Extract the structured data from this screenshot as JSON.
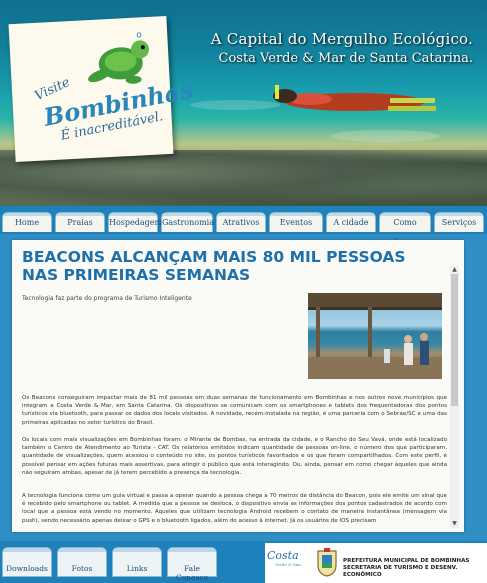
{
  "brand": {
    "visite": "Visite",
    "name": "Bombinhas",
    "tagline": "É inacreditável."
  },
  "headline": {
    "line1": "A Capital do Mergulho Ecológico.",
    "line2": "Costa Verde & Mar de Santa Catarina."
  },
  "nav": [
    "Home",
    "Praias",
    "Hospedagem",
    "Gastronomia",
    "Atrativos",
    "Eventos",
    "A cidade",
    "Como chegar",
    "Serviços"
  ],
  "article": {
    "title": "BEACONS ALCANÇAM MAIS 80 MIL PESSOAS NAS PRIMEIRAS SEMANAS",
    "subtitle": "Tecnologia faz parte do programa de Turismo Inteligente",
    "paragraphs": [
      "Os Beacons conseguiram impactar mais de 81 mil pessoas em duas semanas de funcionamento em Bombinhas e nos outros nove municípios que integram a Costa Verde & Mar, em Santa Catarina. Os dispositivos se comunicam com os smartphones e tablets dos frequentadoras dos pontos turísticos via bluetooth, para passar os dados dos locais visitados. A novidade, recém-instalada na região, é uma parceria com o Sebrae/SC e uma das primeiras aplicadas no setor turístico do Brasil.",
      "Os locais com mais visualizações em Bombinhas foram: o Mirante de Bombas, na entrada da cidade, e o Rancho do Seu Vavá, onde está localizado também o Centro de Atendimento ao Turista - CAT. Os relatórios emitidos indicam quantidade de pessoas on-line, o número dos que participaram, quantidade de visualizações, quem acessou o conteúdo no site, os pontos turísticos favoritados e os que foram compartilhados. Com este perfil, é possível pensar em ações futuras mais assertivas, para atingir o público que está interagindo. Ou, ainda, pensar em como chegar àqueles que ainda não seguiram ambas, apesar de já terem percebido a presença da tecnologia.",
      "A tecnologia funciona como um guia virtual e passa a operar quando a pessoa chega a 70 metros de distância do Beacon, pois ele emite um sinal que é recebido pelo smartphone ou tablet. A medida que a pessoa se desloca, o dispositivo envia as informações dos pontos cadastrados de acordo com local que a pessoa está vendo no momento. Aqueles que utilizam tecnologia Android recebem o contato de maneira instantânea (mensagem via push), sendo necessário apenas deixar o GPS e o bluetooth ligados, além do acesso à internet. Já os usuários de IOS precisam"
    ]
  },
  "scrollbar": {
    "up": "▲",
    "down": "▼"
  },
  "footer": {
    "tabs": [
      "Downloads",
      "Fotos",
      "Links",
      "Fale Conosco"
    ],
    "costa_logo": "Costa",
    "costa_sub": "Verde & Mar",
    "prefeitura_line1": "PREFEITURA MUNICIPAL DE BOMBINHAS",
    "prefeitura_line2": "SECRETARIA DE TURISMO E DESENV. ECONÔMICO"
  },
  "colors": {
    "accent": "#1f6fa8",
    "nav_bg": "#1d82bc",
    "page_bg": "#2f8fc4"
  }
}
